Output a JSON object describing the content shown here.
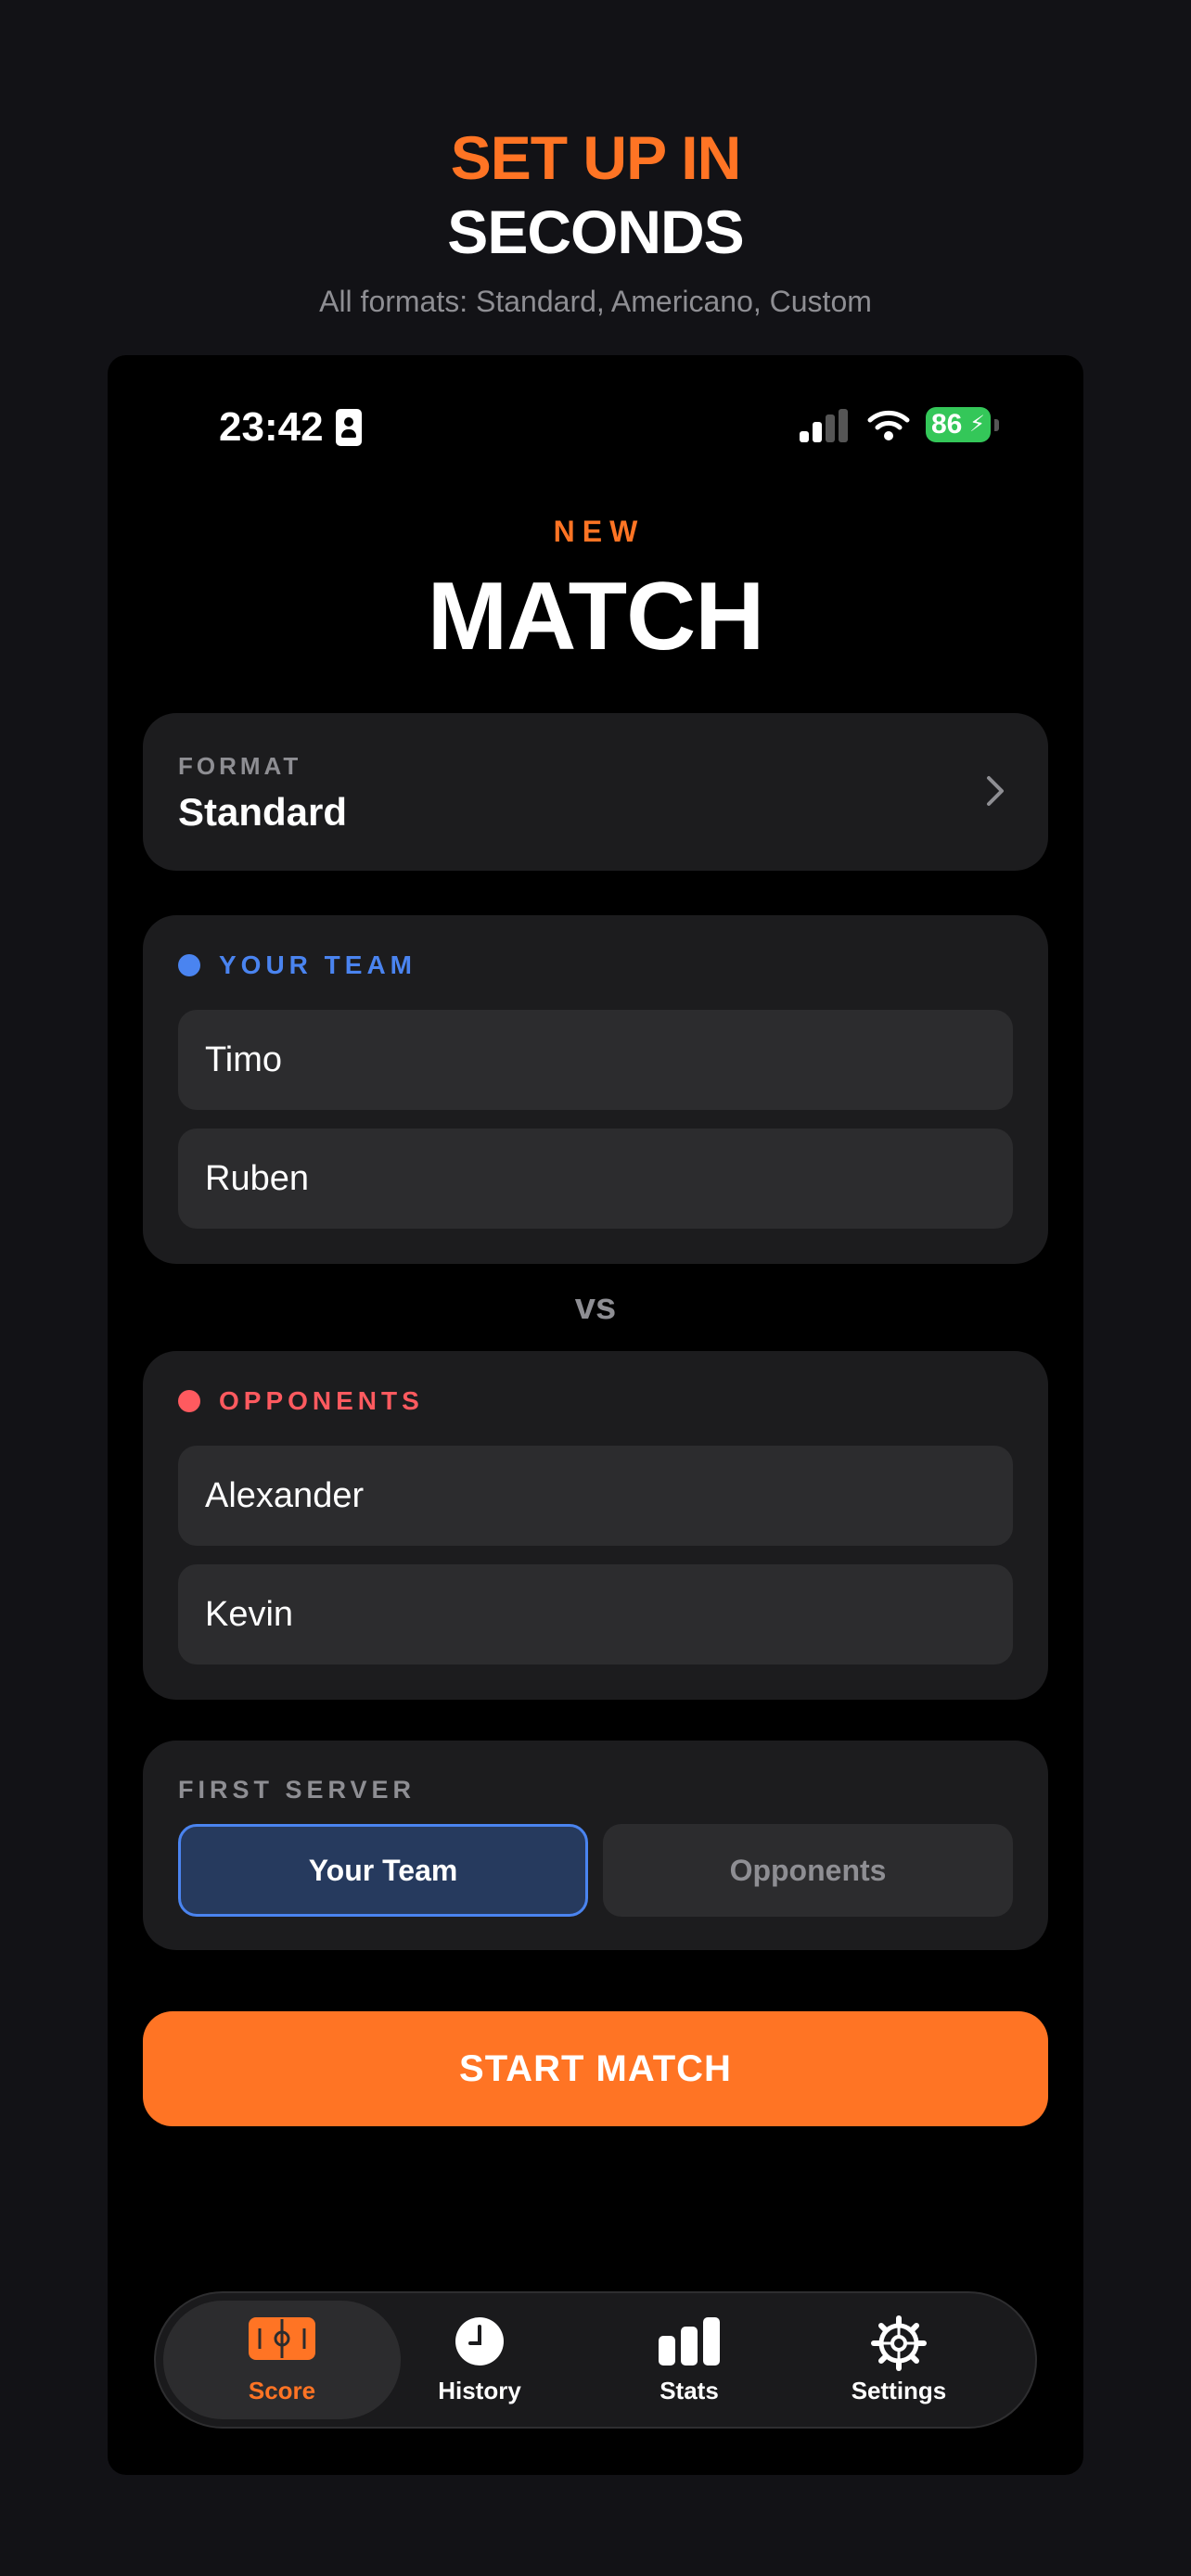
{
  "promo": {
    "line1": "SET UP IN",
    "line2": "SECONDS",
    "subtitle": "All formats: Standard, Americano, Custom"
  },
  "status_bar": {
    "time": "23:42",
    "battery": "86"
  },
  "header": {
    "eyebrow": "NEW",
    "title": "MATCH"
  },
  "format": {
    "label": "FORMAT",
    "value": "Standard"
  },
  "your_team": {
    "label": "YOUR TEAM",
    "color": "#4a84f0",
    "players": [
      "Timo",
      "Ruben"
    ]
  },
  "vs": "vs",
  "opponents": {
    "label": "OPPONENTS",
    "color": "#ff5a5f",
    "players": [
      "Alexander",
      "Kevin"
    ]
  },
  "first_server": {
    "label": "FIRST SERVER",
    "options": [
      "Your Team",
      "Opponents"
    ],
    "selected": "Your Team"
  },
  "start_button": "START MATCH",
  "tabbar": {
    "items": [
      {
        "label": "Score",
        "icon": "court-icon",
        "active": true
      },
      {
        "label": "History",
        "icon": "clock-icon",
        "active": false
      },
      {
        "label": "Stats",
        "icon": "bar-chart-icon",
        "active": false
      },
      {
        "label": "Settings",
        "icon": "gear-icon",
        "active": false
      }
    ]
  },
  "colors": {
    "accent": "#ff7424",
    "background": "#121216",
    "card": "#1c1c1e"
  }
}
